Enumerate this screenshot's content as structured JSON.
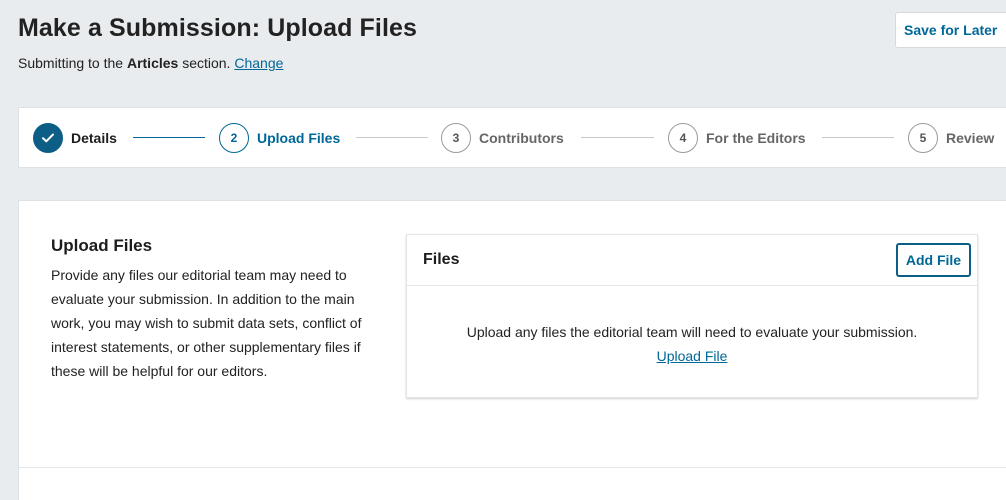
{
  "header": {
    "title": "Make a Submission: Upload Files",
    "subtitle_prefix": "Submitting to the ",
    "section_name": "Articles",
    "subtitle_suffix": " section.",
    "change_link": "Change",
    "save_label": "Save for Later"
  },
  "steps": [
    {
      "number": "",
      "label": "Details",
      "state": "done"
    },
    {
      "number": "2",
      "label": "Upload Files",
      "state": "current"
    },
    {
      "number": "3",
      "label": "Contributors",
      "state": "todo"
    },
    {
      "number": "4",
      "label": "For the Editors",
      "state": "todo"
    },
    {
      "number": "5",
      "label": "Review",
      "state": "todo"
    }
  ],
  "upload_section": {
    "heading": "Upload Files",
    "description": "Provide any files our editorial team may need to evaluate your submission. In addition to the main work, you may wish to submit data sets, conflict of interest statements, or other supplementary files if these will be helpful for our editors."
  },
  "files_panel": {
    "title": "Files",
    "add_button": "Add File",
    "empty_message": "Upload any files the editorial team will need to evaluate your submission.",
    "upload_link": "Upload File"
  },
  "colors": {
    "accent": "#006798",
    "done_step": "#0d5e86",
    "background": "#e9ecee"
  }
}
